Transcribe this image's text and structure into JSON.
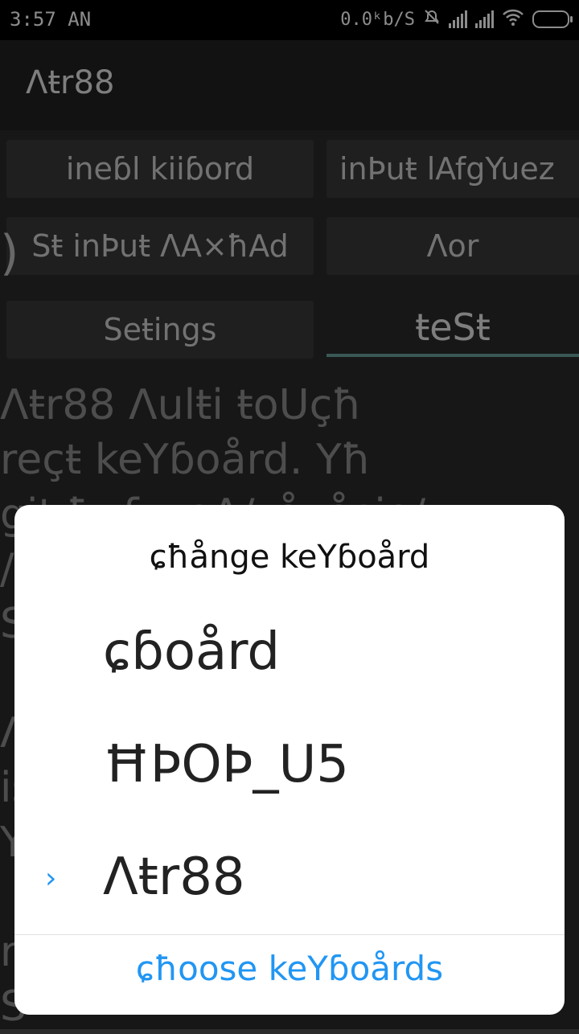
{
  "status_bar": {
    "time": "3:57 AN",
    "net_speed": "0.0ᵏb/S",
    "icons": [
      "mute-icon",
      "signal-icon",
      "signal-icon",
      "wifi-icon",
      "battery-icon"
    ]
  },
  "app_bar": {
    "title": "Λŧr88"
  },
  "buttons": {
    "enable_keyboard": "ineɓl kiiɓord",
    "input_language": "inÞuŧ lAfgYuez",
    "set_input_method": "Sŧ inÞuŧ ΛA×ħAd",
    "more": "Λor",
    "settings": "Seŧings",
    "test": "ŧeSŧ"
  },
  "background_text": "Λŧr88 Λulŧi ŧoUçħ\nreçŧ keYɓoård. Yħ\ngiŧ.ħuɓ.çoΛ/zåvåsio/\n/\nS\n\nΛ\nis\nY\n\nr\nS",
  "dialog": {
    "title": "ɕħånge keYɓoård",
    "items": [
      {
        "label": "ɕɓoård",
        "selected": false
      },
      {
        "label": "ĦÞOÞ_U5",
        "selected": false
      },
      {
        "label": "Λŧr88",
        "selected": true
      }
    ],
    "selected_marker": "›",
    "choose_label": "ɕħoose keYɓoårds"
  },
  "colors": {
    "accent": "#2196f3",
    "tab_indicator": "#6aa39d",
    "app_bar": "#212121",
    "background": "#2b2b2b"
  }
}
